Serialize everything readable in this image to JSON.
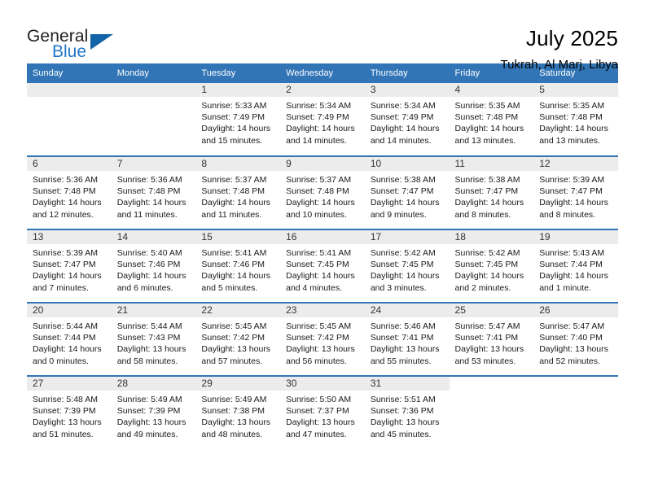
{
  "brand": {
    "name_part1": "General",
    "name_part2": "Blue",
    "triangle_color": "#1263a8",
    "blue_color": "#2277c8"
  },
  "header": {
    "title": "July 2025",
    "subtitle": "Tukrah, Al Marj, Libya"
  },
  "theme": {
    "header_bg": "#3275b6",
    "daynum_bg": "#ececec",
    "rule_color": "#3275b6"
  },
  "weekday_headers": [
    "Sunday",
    "Monday",
    "Tuesday",
    "Wednesday",
    "Thursday",
    "Friday",
    "Saturday"
  ],
  "labels": {
    "sunrise_prefix": "Sunrise:",
    "sunset_prefix": "Sunset:",
    "daylight_prefix": "Daylight:"
  },
  "weeks": [
    [
      {
        "day": "",
        "empty": true,
        "blank_band": true
      },
      {
        "day": "",
        "empty": true,
        "blank_band": true
      },
      {
        "day": "1",
        "sunrise": "Sunrise: 5:33 AM",
        "sunset": "Sunset: 7:49 PM",
        "daylight": "Daylight: 14 hours and 15 minutes."
      },
      {
        "day": "2",
        "sunrise": "Sunrise: 5:34 AM",
        "sunset": "Sunset: 7:49 PM",
        "daylight": "Daylight: 14 hours and 14 minutes."
      },
      {
        "day": "3",
        "sunrise": "Sunrise: 5:34 AM",
        "sunset": "Sunset: 7:49 PM",
        "daylight": "Daylight: 14 hours and 14 minutes."
      },
      {
        "day": "4",
        "sunrise": "Sunrise: 5:35 AM",
        "sunset": "Sunset: 7:48 PM",
        "daylight": "Daylight: 14 hours and 13 minutes."
      },
      {
        "day": "5",
        "sunrise": "Sunrise: 5:35 AM",
        "sunset": "Sunset: 7:48 PM",
        "daylight": "Daylight: 14 hours and 13 minutes."
      }
    ],
    [
      {
        "day": "6",
        "sunrise": "Sunrise: 5:36 AM",
        "sunset": "Sunset: 7:48 PM",
        "daylight": "Daylight: 14 hours and 12 minutes."
      },
      {
        "day": "7",
        "sunrise": "Sunrise: 5:36 AM",
        "sunset": "Sunset: 7:48 PM",
        "daylight": "Daylight: 14 hours and 11 minutes."
      },
      {
        "day": "8",
        "sunrise": "Sunrise: 5:37 AM",
        "sunset": "Sunset: 7:48 PM",
        "daylight": "Daylight: 14 hours and 11 minutes."
      },
      {
        "day": "9",
        "sunrise": "Sunrise: 5:37 AM",
        "sunset": "Sunset: 7:48 PM",
        "daylight": "Daylight: 14 hours and 10 minutes."
      },
      {
        "day": "10",
        "sunrise": "Sunrise: 5:38 AM",
        "sunset": "Sunset: 7:47 PM",
        "daylight": "Daylight: 14 hours and 9 minutes."
      },
      {
        "day": "11",
        "sunrise": "Sunrise: 5:38 AM",
        "sunset": "Sunset: 7:47 PM",
        "daylight": "Daylight: 14 hours and 8 minutes."
      },
      {
        "day": "12",
        "sunrise": "Sunrise: 5:39 AM",
        "sunset": "Sunset: 7:47 PM",
        "daylight": "Daylight: 14 hours and 8 minutes."
      }
    ],
    [
      {
        "day": "13",
        "sunrise": "Sunrise: 5:39 AM",
        "sunset": "Sunset: 7:47 PM",
        "daylight": "Daylight: 14 hours and 7 minutes."
      },
      {
        "day": "14",
        "sunrise": "Sunrise: 5:40 AM",
        "sunset": "Sunset: 7:46 PM",
        "daylight": "Daylight: 14 hours and 6 minutes."
      },
      {
        "day": "15",
        "sunrise": "Sunrise: 5:41 AM",
        "sunset": "Sunset: 7:46 PM",
        "daylight": "Daylight: 14 hours and 5 minutes."
      },
      {
        "day": "16",
        "sunrise": "Sunrise: 5:41 AM",
        "sunset": "Sunset: 7:45 PM",
        "daylight": "Daylight: 14 hours and 4 minutes."
      },
      {
        "day": "17",
        "sunrise": "Sunrise: 5:42 AM",
        "sunset": "Sunset: 7:45 PM",
        "daylight": "Daylight: 14 hours and 3 minutes."
      },
      {
        "day": "18",
        "sunrise": "Sunrise: 5:42 AM",
        "sunset": "Sunset: 7:45 PM",
        "daylight": "Daylight: 14 hours and 2 minutes."
      },
      {
        "day": "19",
        "sunrise": "Sunrise: 5:43 AM",
        "sunset": "Sunset: 7:44 PM",
        "daylight": "Daylight: 14 hours and 1 minute."
      }
    ],
    [
      {
        "day": "20",
        "sunrise": "Sunrise: 5:44 AM",
        "sunset": "Sunset: 7:44 PM",
        "daylight": "Daylight: 14 hours and 0 minutes."
      },
      {
        "day": "21",
        "sunrise": "Sunrise: 5:44 AM",
        "sunset": "Sunset: 7:43 PM",
        "daylight": "Daylight: 13 hours and 58 minutes."
      },
      {
        "day": "22",
        "sunrise": "Sunrise: 5:45 AM",
        "sunset": "Sunset: 7:42 PM",
        "daylight": "Daylight: 13 hours and 57 minutes."
      },
      {
        "day": "23",
        "sunrise": "Sunrise: 5:45 AM",
        "sunset": "Sunset: 7:42 PM",
        "daylight": "Daylight: 13 hours and 56 minutes."
      },
      {
        "day": "24",
        "sunrise": "Sunrise: 5:46 AM",
        "sunset": "Sunset: 7:41 PM",
        "daylight": "Daylight: 13 hours and 55 minutes."
      },
      {
        "day": "25",
        "sunrise": "Sunrise: 5:47 AM",
        "sunset": "Sunset: 7:41 PM",
        "daylight": "Daylight: 13 hours and 53 minutes."
      },
      {
        "day": "26",
        "sunrise": "Sunrise: 5:47 AM",
        "sunset": "Sunset: 7:40 PM",
        "daylight": "Daylight: 13 hours and 52 minutes."
      }
    ],
    [
      {
        "day": "27",
        "sunrise": "Sunrise: 5:48 AM",
        "sunset": "Sunset: 7:39 PM",
        "daylight": "Daylight: 13 hours and 51 minutes."
      },
      {
        "day": "28",
        "sunrise": "Sunrise: 5:49 AM",
        "sunset": "Sunset: 7:39 PM",
        "daylight": "Daylight: 13 hours and 49 minutes."
      },
      {
        "day": "29",
        "sunrise": "Sunrise: 5:49 AM",
        "sunset": "Sunset: 7:38 PM",
        "daylight": "Daylight: 13 hours and 48 minutes."
      },
      {
        "day": "30",
        "sunrise": "Sunrise: 5:50 AM",
        "sunset": "Sunset: 7:37 PM",
        "daylight": "Daylight: 13 hours and 47 minutes."
      },
      {
        "day": "31",
        "sunrise": "Sunrise: 5:51 AM",
        "sunset": "Sunset: 7:36 PM",
        "daylight": "Daylight: 13 hours and 45 minutes."
      },
      {
        "day": "",
        "empty": true,
        "blank_band": false
      },
      {
        "day": "",
        "empty": true,
        "blank_band": false
      }
    ]
  ]
}
